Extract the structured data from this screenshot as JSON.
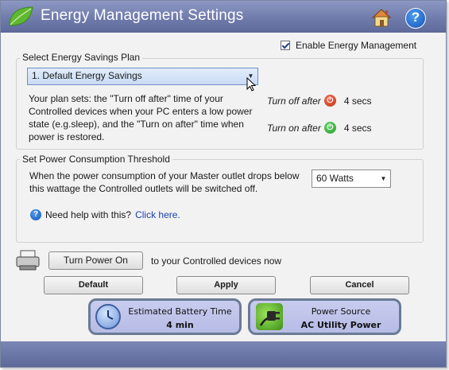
{
  "window": {
    "title": "Energy Management Settings"
  },
  "toolbar": {
    "home_icon": "home-icon",
    "help_icon": "help-icon",
    "help_glyph": "?"
  },
  "enable": {
    "label": "Enable Energy Management",
    "checked": true
  },
  "plan": {
    "legend": "Select Energy Savings Plan",
    "selected": "1. Default Energy Savings",
    "description": "Your plan sets: the \"Turn off after\" time of your Controlled devices when your PC enters a low power state (e.g.sleep), and the \"Turn on after\" time when power is restored.",
    "turn_off_label": "Turn off after",
    "turn_off_value": "4 secs",
    "turn_on_label": "Turn on after",
    "turn_on_value": "4 secs"
  },
  "threshold": {
    "legend": "Set Power Consumption Threshold",
    "description": "When the power consumption of your Master outlet drops below this wattage the Controlled outlets will be switched off.",
    "selected": "60 Watts",
    "help_text": "Need help with this?",
    "help_link": "Click here."
  },
  "power": {
    "button": "Turn Power On",
    "suffix": "to your Controlled devices now"
  },
  "actions": {
    "default": "Default",
    "apply": "Apply",
    "cancel": "Cancel"
  },
  "status": {
    "battery_caption": "Estimated Battery Time",
    "battery_value": "4 min",
    "source_caption": "Power Source",
    "source_value": "AC Utility Power"
  },
  "colors": {
    "titlebar": "#7381b0",
    "accent": "#23408e",
    "link": "#1a3fb0"
  }
}
